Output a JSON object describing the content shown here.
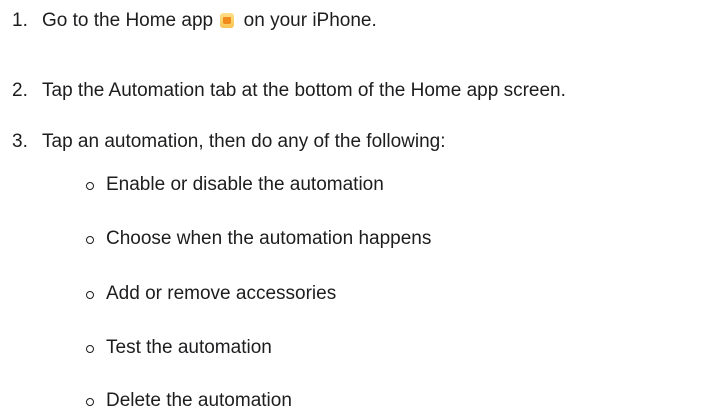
{
  "steps": [
    {
      "number": "1.",
      "before_icon": "Go to the Home app",
      "icon": "home-app-icon",
      "after_icon": "on your iPhone."
    },
    {
      "number": "2.",
      "text": "Tap the Automation tab at the bottom of the Home app screen."
    },
    {
      "number": "3.",
      "text": "Tap an automation, then do any of the following:"
    }
  ],
  "sub_steps": [
    "Enable or disable the automation",
    "Choose when the automation happens",
    "Add or remove accessories",
    "Test the automation",
    "Delete the automation"
  ]
}
